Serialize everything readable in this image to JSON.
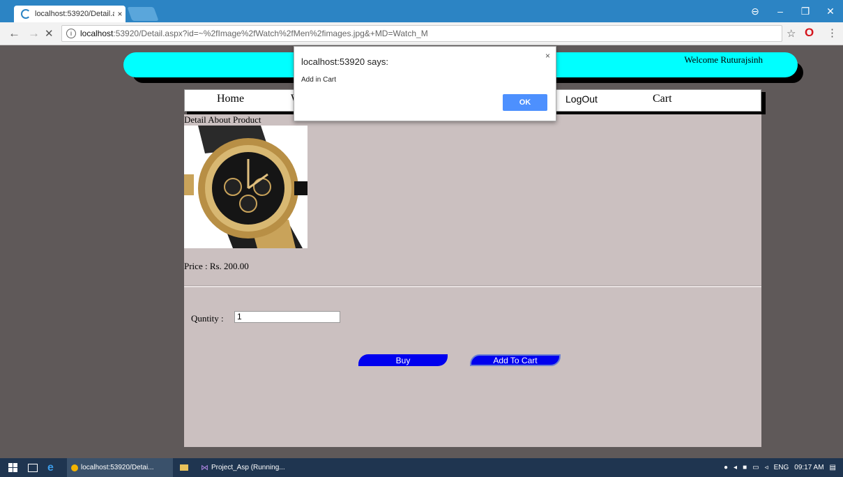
{
  "browser": {
    "tab_title": "localhost:53920/Detail.as",
    "tab_close": "×",
    "url_host": "localhost",
    "url_rest": ":53920/Detail.aspx?id=~%2fImage%2fWatch%2fMen%2fimages.jpg&+MD=Watch_M",
    "back": "←",
    "forward": "→",
    "stop": "✕",
    "info": "i",
    "bookmark": "☆",
    "opera": "O",
    "menu": "⋮",
    "profile": "⊖",
    "minimize": "–",
    "restore": "❐",
    "close": "✕"
  },
  "header": {
    "welcome": "Welcome Ruturajsinh"
  },
  "menu": {
    "home": "Home",
    "hidden_item": "W",
    "logout": "LogOut",
    "cart": "Cart"
  },
  "content": {
    "title": "Detail About Product",
    "price": "Price : Rs. 200.00",
    "qty_label": "Quntity :",
    "qty_value": "1",
    "buy": "Buy",
    "add_to_cart": "Add To Cart"
  },
  "dialog": {
    "title": "localhost:53920 says:",
    "message": "Add in Cart",
    "ok": "OK",
    "close": "×"
  },
  "taskbar": {
    "chrome": "localhost:53920/Detai...",
    "vs": "Project_Asp (Running...",
    "lang": "ENG",
    "time": "09:17 AM"
  }
}
